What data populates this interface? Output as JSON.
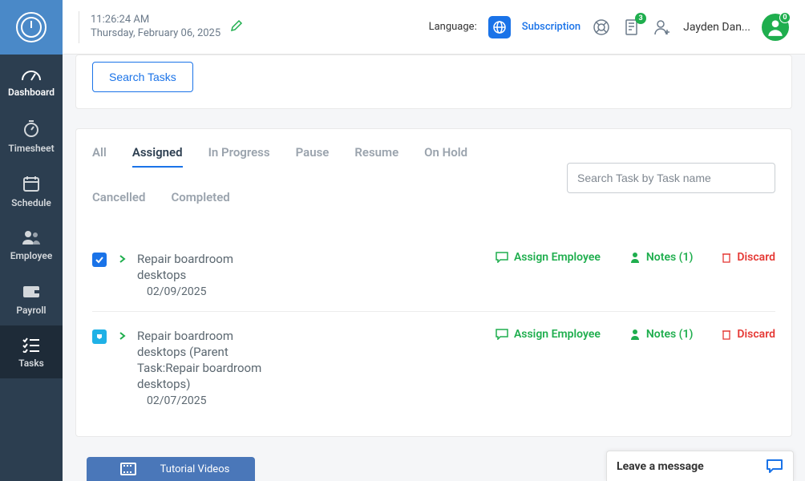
{
  "datetime": {
    "time": "11:26:24 AM",
    "date": "Thursday, February 06, 2025"
  },
  "topbar": {
    "language_label": "Language:",
    "subscription": "Subscription",
    "doc_badge": "3",
    "user_name": "Jayden Dan...",
    "avatar_badge": "0"
  },
  "sidebar": [
    {
      "key": "dashboard",
      "label": "Dashboard"
    },
    {
      "key": "timesheet",
      "label": "Timesheet"
    },
    {
      "key": "schedule",
      "label": "Schedule"
    },
    {
      "key": "employee",
      "label": "Employee"
    },
    {
      "key": "payroll",
      "label": "Payroll"
    },
    {
      "key": "tasks",
      "label": "Tasks"
    }
  ],
  "search_tasks_btn": "Search Tasks",
  "tabs": {
    "all": "All",
    "assigned": "Assigned",
    "in_progress": "In Progress",
    "pause": "Pause",
    "resume": "Resume",
    "on_hold": "On Hold",
    "cancelled": "Cancelled",
    "completed": "Completed"
  },
  "task_search_placeholder": "Search Task by Task name",
  "tasks": [
    {
      "title": "Repair boardroom desktops",
      "date": "02/09/2025",
      "notes": "Notes (1)"
    },
    {
      "title": "Repair boardroom desktops (Parent Task:Repair boardroom desktops)",
      "date": "02/07/2025",
      "notes": "Notes (1)"
    }
  ],
  "actions": {
    "assign": "Assign Employee",
    "discard": "Discard"
  },
  "tutorial": "Tutorial Videos",
  "chat": "Leave a message"
}
